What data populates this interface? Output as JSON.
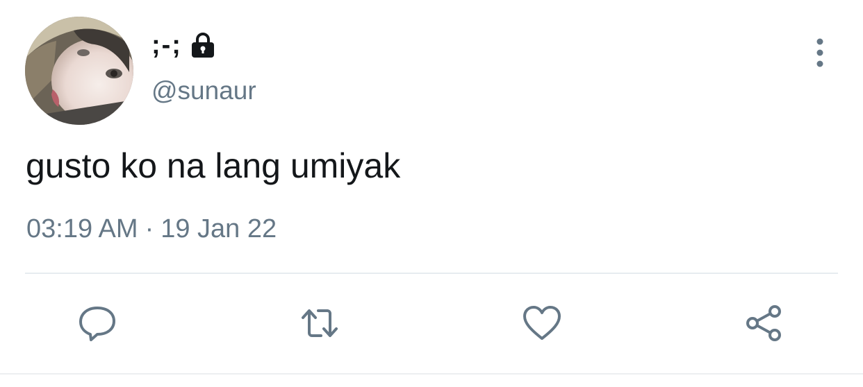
{
  "tweet": {
    "display_name": ";-;",
    "handle": "@sunaur",
    "text": "gusto ko na lang umiyak",
    "time": "03:19 AM",
    "separator": "·",
    "date": "19 Jan 22"
  },
  "icons": {
    "lock": "lock-icon",
    "more": "more-vertical-icon",
    "reply": "reply-icon",
    "retweet": "retweet-icon",
    "like": "heart-icon",
    "share": "share-icon"
  },
  "colors": {
    "primary_text": "#14171a",
    "secondary_text": "#657786",
    "divider": "#e6ecf0"
  }
}
